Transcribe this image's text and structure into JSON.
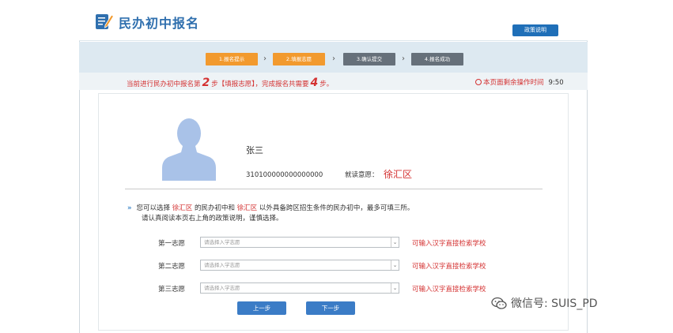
{
  "header": {
    "title": "民办初中报名",
    "policy_button": "政策说明"
  },
  "steps": [
    {
      "label": "1.报名提示",
      "state": "done"
    },
    {
      "label": "2.填报志愿",
      "state": "done"
    },
    {
      "label": "3.确认提交",
      "state": "todo"
    },
    {
      "label": "4.报名成功",
      "state": "todo"
    }
  ],
  "status": {
    "prefix": "当前进行民办初中报名第",
    "current_step": "2",
    "middle": "步【填报志愿】，完成报名共需要",
    "total_steps": "4",
    "suffix": "步。",
    "timer_label": "本页面剩余操作时间",
    "timer_value": "9:50"
  },
  "student": {
    "name": "张三",
    "id": "310100000000000000",
    "district_label": "就读意愿：",
    "district_value": "徐汇区"
  },
  "notice": {
    "part1": "您可以选择",
    "district1": "徐汇区",
    "part2": "的民办初中和",
    "district2": "徐汇区",
    "part3": "以外具备跨区招生条件的民办初中，最多可填三所。",
    "line2": "请认真阅读本页右上角的政策说明，谨慎选择。"
  },
  "preferences": [
    {
      "label": "第一志愿",
      "placeholder": "请选择入学志愿",
      "hint": "可输入汉字直接检索学校"
    },
    {
      "label": "第二志愿",
      "placeholder": "请选择入学志愿",
      "hint": "可输入汉字直接检索学校"
    },
    {
      "label": "第三志愿",
      "placeholder": "请选择入学志愿",
      "hint": "可输入汉字直接检索学校"
    }
  ],
  "buttons": {
    "prev": "上一步",
    "next": "下一步"
  },
  "wechat": {
    "text": "微信号: SUIS_PD"
  },
  "colors": {
    "brand_blue": "#2f6fae",
    "step_done": "#f29a2e",
    "step_todo": "#66707a",
    "alert_red": "#d43232",
    "button_blue": "#3b7cc6"
  }
}
